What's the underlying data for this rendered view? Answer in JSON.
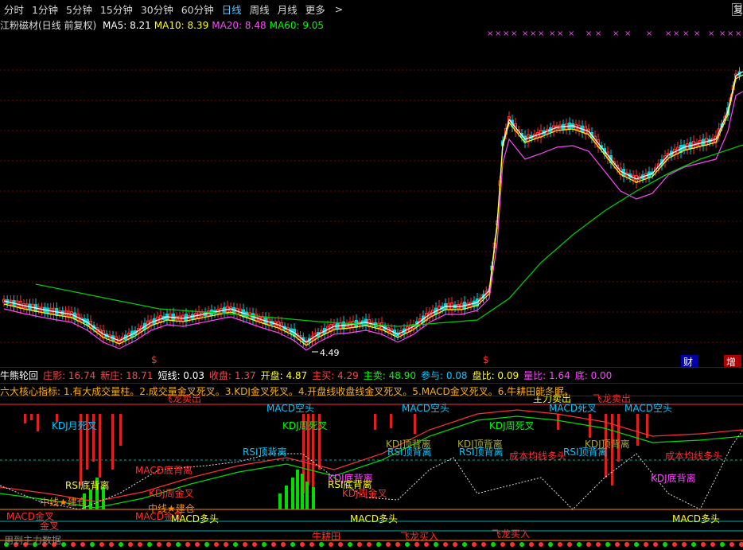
{
  "period_tabs": [
    {
      "label": "分时",
      "active": false
    },
    {
      "label": "1分钟",
      "active": false
    },
    {
      "label": "5分钟",
      "active": false
    },
    {
      "label": "15分钟",
      "active": false
    },
    {
      "label": "30分钟",
      "active": false
    },
    {
      "label": "60分钟",
      "active": false
    },
    {
      "label": "日线",
      "active": true
    },
    {
      "label": "周线",
      "active": false
    },
    {
      "label": "月线",
      "active": false
    },
    {
      "label": "更多",
      "active": false
    }
  ],
  "more_arrow": ">",
  "right_edge_label": "复",
  "stock_title": "江粉磁材(日线 前复权)",
  "ma": [
    {
      "label": "MA5: 8.21",
      "color": "#ffffff"
    },
    {
      "label": "MA10: 8.39",
      "color": "#ffff00"
    },
    {
      "label": "MA20: 8.48",
      "color": "#ff44ff"
    },
    {
      "label": "MA60: 9.05",
      "color": "#00ff00"
    }
  ],
  "low_price_label": "4.49",
  "marker_caiwu": "财",
  "marker_zeng": "增",
  "indicator_row1": [
    {
      "text": "牛熊轮回",
      "color": "#ffffff"
    },
    {
      "text": "庄影: 16.74",
      "color": "#ff4444"
    },
    {
      "text": "新庄: 18.71",
      "color": "#ff4444"
    },
    {
      "text": "短线: 0.03",
      "color": "#ffffff"
    },
    {
      "text": "收盘: 1.37",
      "color": "#ff4444"
    },
    {
      "text": "开盘: 4.87",
      "color": "#ffff00"
    },
    {
      "text": "主买: 4.29",
      "color": "#ff4444"
    },
    {
      "text": "主卖: 48.90",
      "color": "#00ff00"
    },
    {
      "text": "参与: 0.08",
      "color": "#00c8ff"
    },
    {
      "text": "盘比: 0.09",
      "color": "#ffff00"
    },
    {
      "text": "量比: 1.64",
      "color": "#ff44ff"
    },
    {
      "text": "底: 0.00",
      "color": "#ff44ff"
    }
  ],
  "indicator_row2": "六大核心指标: 1.有大成交量including柱。2.成交量金叉死叉。3.KDJ金叉死叉。4.开盘线收盘线金叉死叉。5.MACD金叉死叉。6.牛耕田能冬眠。",
  "signals": [
    {
      "text": "飞龙卖出",
      "color": "#ff3030"
    },
    {
      "text": "MACD空头",
      "color": "#00c8ff"
    },
    {
      "text": "MACD空头",
      "color": "#00c8ff"
    },
    {
      "text": "MACD死叉",
      "color": "#00c8ff"
    },
    {
      "text": "MACD空头",
      "color": "#00c8ff"
    },
    {
      "text": "主力卖出",
      "color": "#ffff00"
    },
    {
      "text": "飞龙卖出",
      "color": "#ff3030"
    },
    {
      "text": "KDJ月死叉",
      "color": "#00c8ff"
    },
    {
      "text": "KDJ周死叉",
      "color": "#00ff00"
    },
    {
      "text": "KDJ周死叉",
      "color": "#00ff00"
    },
    {
      "text": "KDJ顶背离",
      "color": "#aaaa33"
    },
    {
      "text": "KDJ顶背离",
      "color": "#aaaa33"
    },
    {
      "text": "KDJ顶背离",
      "color": "#aaaa33"
    },
    {
      "text": "RSI顶背离",
      "color": "#00c8ff"
    },
    {
      "text": "RSI顶背离",
      "color": "#00c8ff"
    },
    {
      "text": "RSI顶背离",
      "color": "#00c8ff"
    },
    {
      "text": "RSI顶背离",
      "color": "#00c8ff"
    },
    {
      "text": "成本均线多头",
      "color": "#ff3030"
    },
    {
      "text": "成本均线多头",
      "color": "#ff3030"
    },
    {
      "text": "MACD底背离",
      "color": "#ff3030"
    },
    {
      "text": "KDJ底背离",
      "color": "#ff44ff"
    },
    {
      "text": "KDJ底背离",
      "color": "#ff44ff"
    },
    {
      "text": "RSI底背离",
      "color": "#ffff00"
    },
    {
      "text": "RSI底背离",
      "color": "#ffff00"
    },
    {
      "text": "KDJ周金叉",
      "color": "#ff3030"
    },
    {
      "text": "KDJ周金叉",
      "color": "#ff3030"
    },
    {
      "text": "中线★建仓",
      "color": "#ff8800"
    },
    {
      "text": "中线★建仓",
      "color": "#ff8800"
    },
    {
      "text": "MACD金叉",
      "color": "#ff3030"
    },
    {
      "text": "MACD金叉",
      "color": "#ff3030"
    },
    {
      "text": "MACD多头",
      "color": "#ffff00"
    },
    {
      "text": "MACD多头",
      "color": "#ffff00"
    },
    {
      "text": "MACD多头",
      "color": "#ffff00"
    },
    {
      "text": "牛耕田",
      "color": "#ff3030"
    },
    {
      "text": "飞龙买入",
      "color": "#ff3030"
    },
    {
      "text": "飞龙买入",
      "color": "#ff3030"
    },
    {
      "text": "金叉",
      "color": "#ff3030"
    }
  ],
  "bottom_text": "用到主力数据"
}
